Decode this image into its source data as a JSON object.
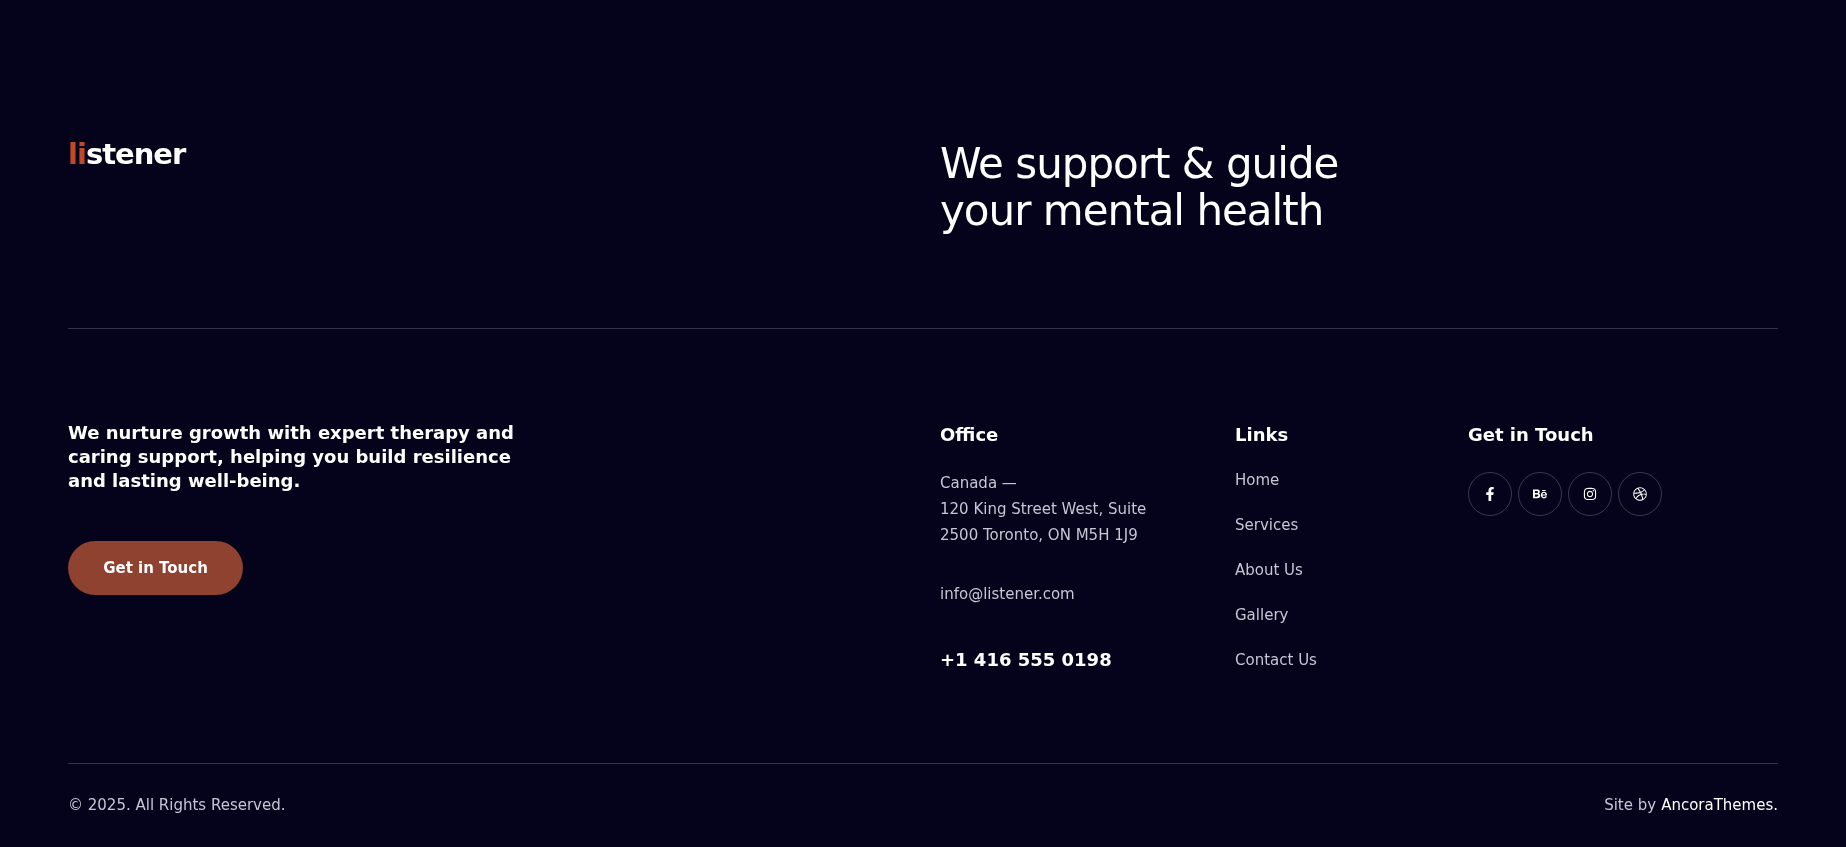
{
  "logo": {
    "accent": "li",
    "text": "stener"
  },
  "headline": [
    "We support & guide",
    "your mental health"
  ],
  "tagline": "We nurture growth with expert therapy and caring support, helping you build resilience and lasting well-being.",
  "cta_button": "Get in Touch",
  "office": {
    "heading": "Office",
    "address": [
      "Canada —",
      "120 King Street West, Suite",
      "2500 Toronto, ON M5H 1J9"
    ],
    "email": "info@listener.com",
    "phone": "+1 416 555 0198"
  },
  "links": {
    "heading": "Links",
    "items": [
      "Home",
      "Services",
      "About Us",
      "Gallery",
      "Contact Us"
    ]
  },
  "contact": {
    "heading": "Get in Touch",
    "socials": [
      {
        "kind": "facebook"
      },
      {
        "kind": "behance"
      },
      {
        "kind": "instagram"
      },
      {
        "kind": "dribbble"
      }
    ]
  },
  "bottom_bar": {
    "copyright": "© 2025. All Rights Reserved.",
    "credit_prefix": "Site by",
    "credit_link": "AncoraThemes."
  }
}
